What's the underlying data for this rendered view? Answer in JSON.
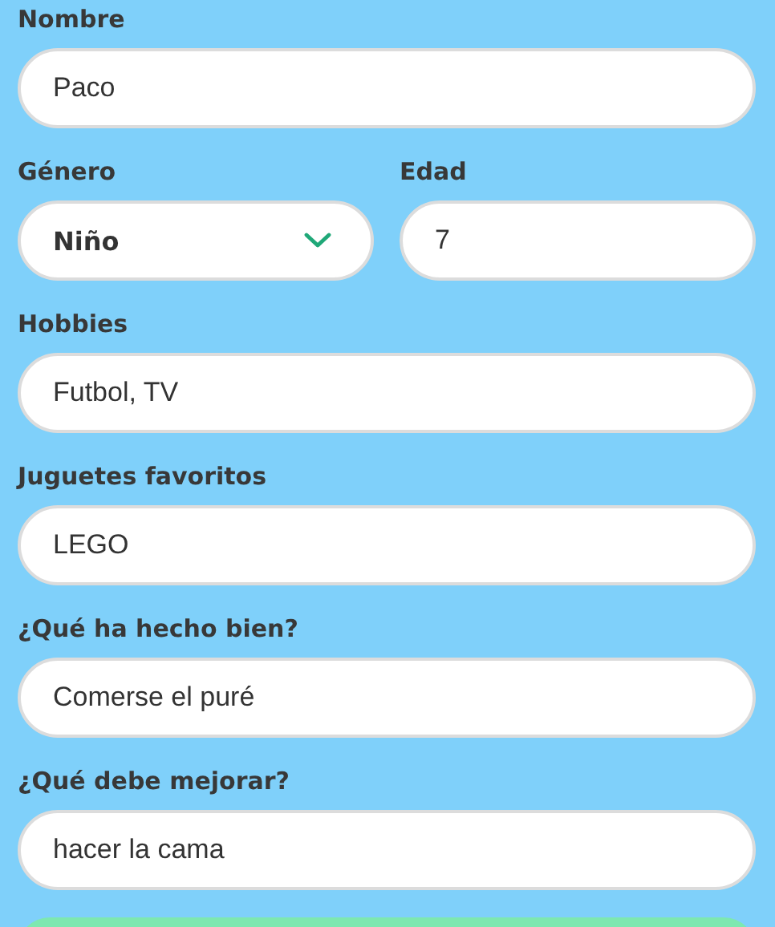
{
  "rows": [
    [
      {
        "label": "Nombre",
        "kind": "text",
        "value": "Paco"
      }
    ],
    [
      {
        "label": "Género",
        "kind": "select",
        "value": "Niño"
      },
      {
        "label": "Edad",
        "kind": "text",
        "value": "7"
      }
    ],
    [
      {
        "label": "Hobbies",
        "kind": "text",
        "value": "Futbol, TV"
      }
    ],
    [
      {
        "label": "Juguetes favoritos",
        "kind": "text",
        "value": "LEGO"
      }
    ],
    [
      {
        "label": "¿Qué ha hecho bien?",
        "kind": "text",
        "value": "Comerse el puré"
      }
    ],
    [
      {
        "label": "¿Qué debe mejorar?",
        "kind": "text",
        "value": "hacer la cama"
      }
    ]
  ]
}
